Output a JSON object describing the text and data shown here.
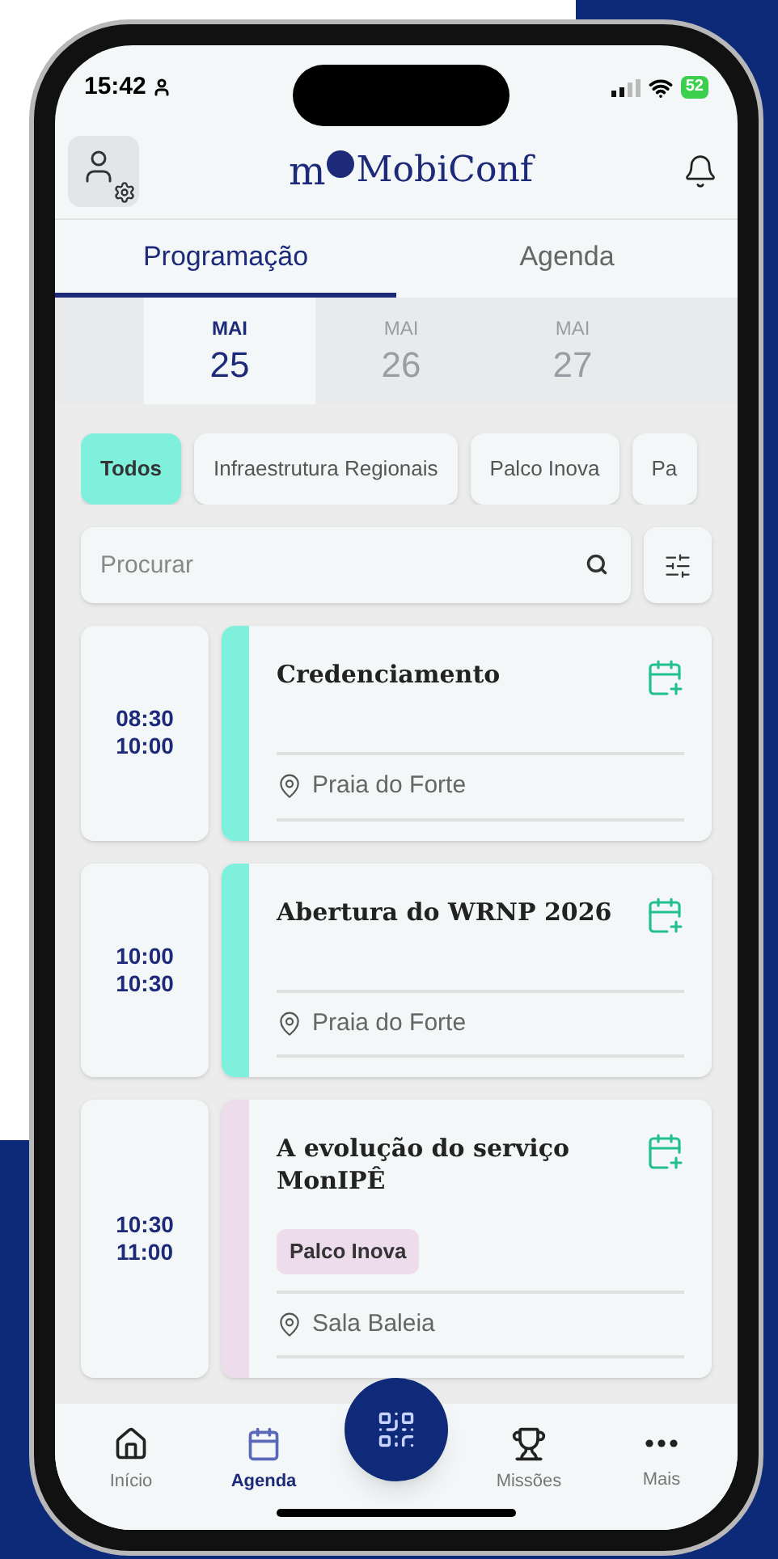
{
  "status_bar": {
    "time": "15:42",
    "battery": "52"
  },
  "header": {
    "logo_prefix": "m",
    "logo": "MobiConf"
  },
  "tabs": [
    {
      "label": "Programação",
      "selected": true
    },
    {
      "label": "Agenda",
      "selected": false
    }
  ],
  "dates": [
    {
      "month": "MAI",
      "day": "25",
      "selected": true
    },
    {
      "month": "MAI",
      "day": "26",
      "selected": false
    },
    {
      "month": "MAI",
      "day": "27",
      "selected": false
    }
  ],
  "filters": [
    {
      "label": "Todos",
      "selected": true
    },
    {
      "label": "Infraestrutura Regionais",
      "selected": false
    },
    {
      "label": "Palco Inova",
      "selected": false
    },
    {
      "label": "Pa",
      "selected": false
    }
  ],
  "search": {
    "placeholder": "Procurar"
  },
  "events": [
    {
      "start": "08:30",
      "end": "10:00",
      "title": "Credenciamento",
      "location": "Praia do Forte",
      "color": "#7ff0dc"
    },
    {
      "start": "10:00",
      "end": "10:30",
      "title": "Abertura do WRNP 2026",
      "location": "Praia do Forte",
      "color": "#7ff0dc"
    },
    {
      "start": "10:30",
      "end": "11:00",
      "title": "A evolução do serviço MonIPÊ",
      "tag": "Palco Inova",
      "location": "Sala Baleia",
      "color": "#ecdcec"
    }
  ],
  "bottom_nav": [
    {
      "label": "Início",
      "kind": "home",
      "selected": false
    },
    {
      "label": "Agenda",
      "kind": "calendar",
      "selected": true
    },
    {
      "kind": "qr",
      "selected": false
    },
    {
      "label": "Missões",
      "kind": "trophy",
      "selected": false
    },
    {
      "label": "Mais",
      "kind": "more",
      "selected": false
    }
  ]
}
